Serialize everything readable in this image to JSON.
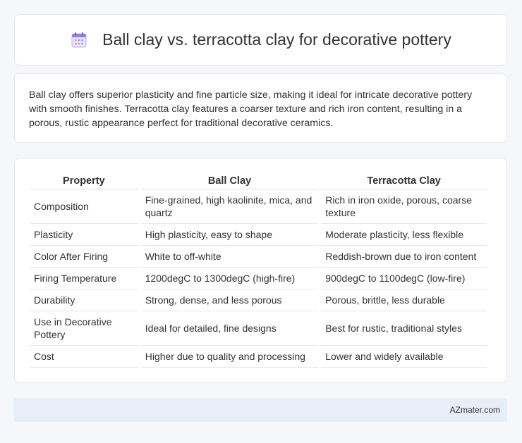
{
  "header": {
    "title": "Ball clay vs. terracotta clay for decorative pottery",
    "icon": "calendar-icon"
  },
  "intro": {
    "text": "Ball clay offers superior plasticity and fine particle size, making it ideal for intricate decorative pottery with smooth finishes. Terracotta clay features a coarser texture and rich iron content, resulting in a porous, rustic appearance perfect for traditional decorative ceramics."
  },
  "table": {
    "headers": [
      "Property",
      "Ball Clay",
      "Terracotta Clay"
    ],
    "rows": [
      [
        "Composition",
        "Fine-grained, high kaolinite, mica, and quartz",
        "Rich in iron oxide, porous, coarse texture"
      ],
      [
        "Plasticity",
        "High plasticity, easy to shape",
        "Moderate plasticity, less flexible"
      ],
      [
        "Color After Firing",
        "White to off-white",
        "Reddish-brown due to iron content"
      ],
      [
        "Firing Temperature",
        "1200degC to 1300degC (high-fire)",
        "900degC to 1100degC (low-fire)"
      ],
      [
        "Durability",
        "Strong, dense, and less porous",
        "Porous, brittle, less durable"
      ],
      [
        "Use in Decorative Pottery",
        "Ideal for detailed, fine designs",
        "Best for rustic, traditional styles"
      ],
      [
        "Cost",
        "Higher due to quality and processing",
        "Lower and widely available"
      ]
    ]
  },
  "footer": {
    "text": "AZmater.com"
  },
  "colors": {
    "page_bg": "#f5f7fa",
    "card_bg": "#ffffff",
    "footer_bg": "#e8eef8"
  }
}
